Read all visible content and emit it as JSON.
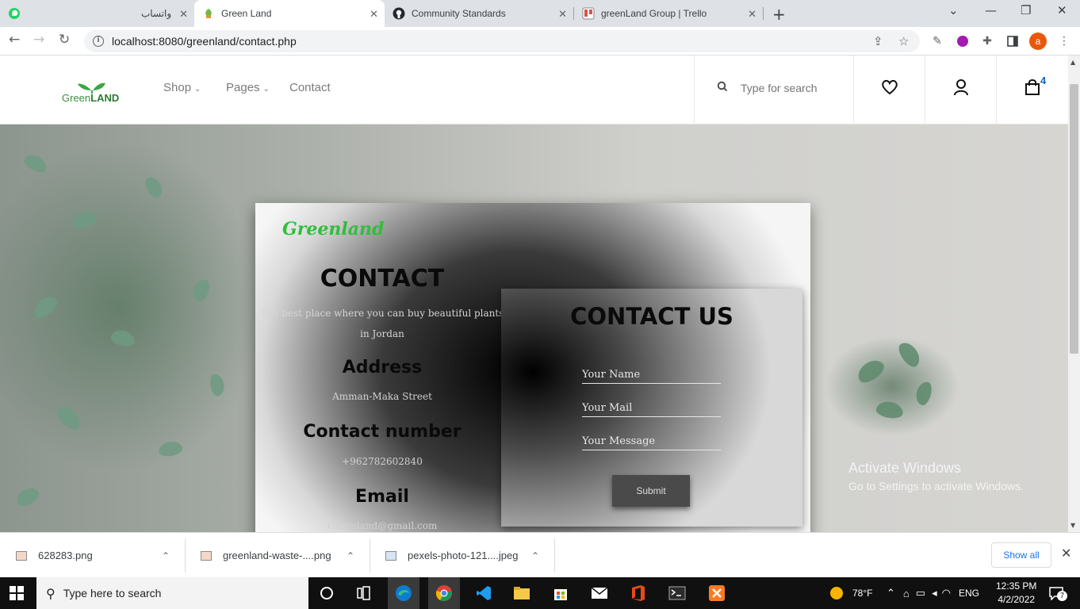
{
  "browser": {
    "tabs": [
      {
        "label": "واتساب",
        "icon": "whatsapp-icon"
      },
      {
        "label": "Green Land",
        "icon": "greenland-favicon",
        "active": true
      },
      {
        "label": "Community Standards",
        "icon": "github-icon"
      },
      {
        "label": "greenLand Group | Trello",
        "icon": "trello-icon"
      }
    ],
    "url": "localhost:8080/greenland/contact.php"
  },
  "site": {
    "logo_text_1": "Green",
    "logo_text_2": "LAND",
    "nav": [
      {
        "label": "Shop"
      },
      {
        "label": "Pages"
      },
      {
        "label": "Contact"
      }
    ],
    "search_placeholder": "Type for search",
    "cart_count": "4"
  },
  "contact_card": {
    "brand": "Greenland",
    "heading": "CONTACT",
    "tagline": "The best place where you can buy beautiful plants in Jordan",
    "address_heading": "Address",
    "address_value": "Amman-Maka Street",
    "number_heading": "Contact number",
    "number_value": "+962782602840",
    "email_heading": "Email",
    "email_value": "Greenland@gmail.com"
  },
  "contact_form": {
    "title": "CONTACT US",
    "name_placeholder": "Your Name",
    "mail_placeholder": "Your Mail",
    "message_placeholder": "Your Message",
    "submit_label": "Submit"
  },
  "watermark": {
    "line1": "Activate Windows",
    "line2": "Go to Settings to activate Windows."
  },
  "downloads": {
    "items": [
      {
        "name": "628283.png"
      },
      {
        "name": "greenland-waste-....png"
      },
      {
        "name": "pexels-photo-121....jpeg"
      }
    ],
    "show_all": "Show all"
  },
  "taskbar": {
    "search_placeholder": "Type here to search",
    "weather": "78°F",
    "language": "ENG",
    "time": "12:35 PM",
    "date": "4/2/2022",
    "notifications": "7"
  },
  "colors": {
    "brand_green": "#2fbf3b",
    "cart_badge": "#1565c0",
    "link_blue": "#1a73e8"
  }
}
